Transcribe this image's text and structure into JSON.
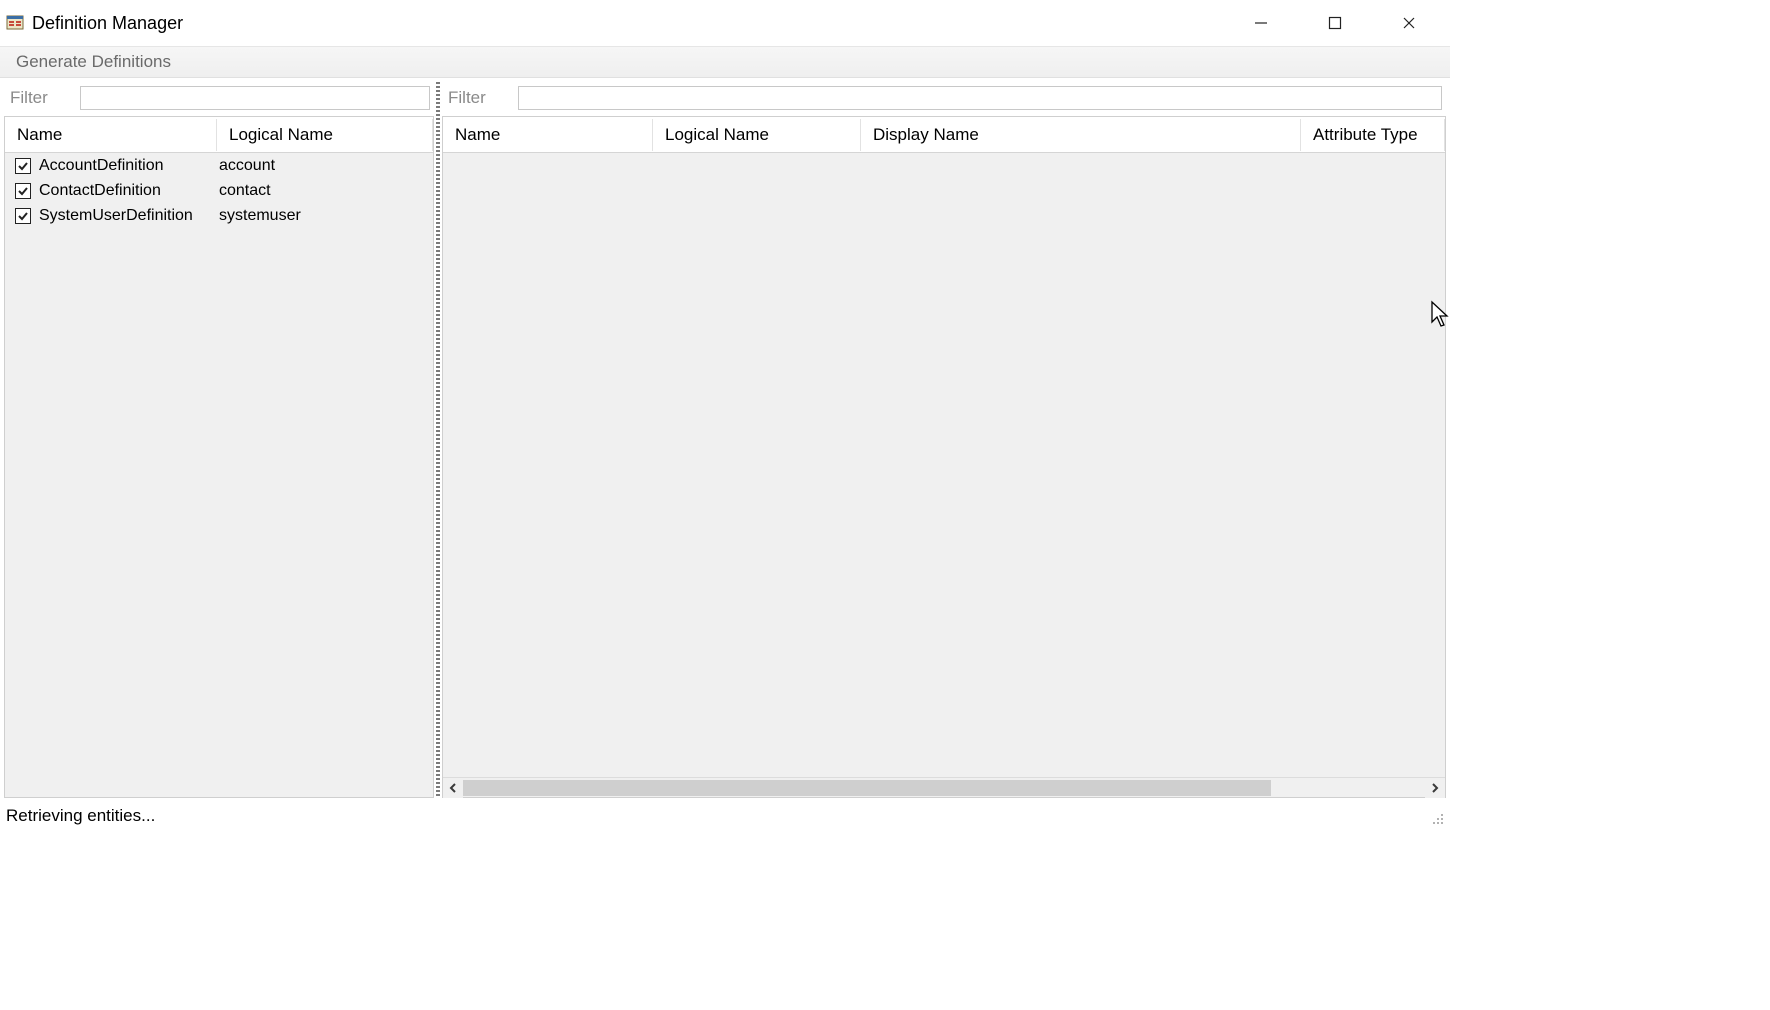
{
  "window": {
    "title": "Definition Manager"
  },
  "toolbar": {
    "generate_label": "Generate Definitions"
  },
  "left": {
    "filter_label": "Filter",
    "filter_value": "",
    "columns": {
      "name": "Name",
      "logical": "Logical Name"
    },
    "rows": [
      {
        "checked": true,
        "name": "AccountDefinition",
        "logical": "account"
      },
      {
        "checked": true,
        "name": "ContactDefinition",
        "logical": "contact"
      },
      {
        "checked": true,
        "name": "SystemUserDefinition",
        "logical": "systemuser"
      }
    ]
  },
  "right": {
    "filter_label": "Filter",
    "filter_value": "",
    "columns": {
      "name": "Name",
      "logical": "Logical Name",
      "display": "Display Name",
      "type": "Attribute Type"
    }
  },
  "status": {
    "text": "Retrieving entities..."
  }
}
